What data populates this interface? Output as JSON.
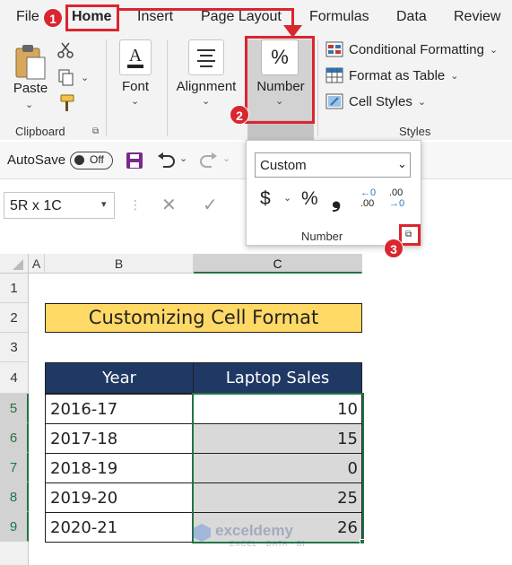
{
  "tabs": {
    "file": "File",
    "home": "Home",
    "insert": "Insert",
    "page_layout": "Page Layout",
    "formulas": "Formulas",
    "data": "Data",
    "review": "Review"
  },
  "callouts": {
    "one": "1",
    "two": "2",
    "three": "3"
  },
  "clipboard": {
    "paste": "Paste",
    "group_label": "Clipboard"
  },
  "font": {
    "label": "Font"
  },
  "alignment": {
    "label": "Alignment"
  },
  "number": {
    "symbol": "%",
    "label": "Number"
  },
  "styles": {
    "conditional": "Conditional Formatting",
    "format_table": "Format as Table",
    "cell_styles": "Cell Styles",
    "group_label": "Styles"
  },
  "qat": {
    "autosave": "AutoSave",
    "toggle": "Off"
  },
  "number_panel": {
    "format_value": "Custom",
    "currency": "$",
    "percent": "%",
    "comma": "❟",
    "inc_dec_top": "←0",
    "inc_dec_bot": ".00",
    "dec_dec_top": ".00",
    "dec_dec_bot": "→0",
    "label": "Number"
  },
  "name_box": {
    "value": "5R x 1C"
  },
  "formula_bar": {
    "cancel": "✕",
    "enter": "✓"
  },
  "columns": [
    "A",
    "B",
    "C"
  ],
  "rows": [
    "1",
    "2",
    "3",
    "4",
    "5",
    "6",
    "7",
    "8",
    "9"
  ],
  "sheet": {
    "title": "Customizing Cell Format",
    "headers": [
      "Year",
      "Laptop Sales"
    ],
    "data": [
      {
        "year": "2016-17",
        "sales": "10"
      },
      {
        "year": "2017-18",
        "sales": "15"
      },
      {
        "year": "2018-19",
        "sales": "0"
      },
      {
        "year": "2019-20",
        "sales": "25"
      },
      {
        "year": "2020-21",
        "sales": "26"
      }
    ]
  },
  "watermark": {
    "name": "exceldemy",
    "tag": "EXCEL · DATA · BI"
  },
  "colors": {
    "accent_red": "#d9262f",
    "header_navy": "#203864",
    "title_yellow": "#ffd966",
    "selection": "#d9d9d9",
    "excel_green": "#217346"
  }
}
